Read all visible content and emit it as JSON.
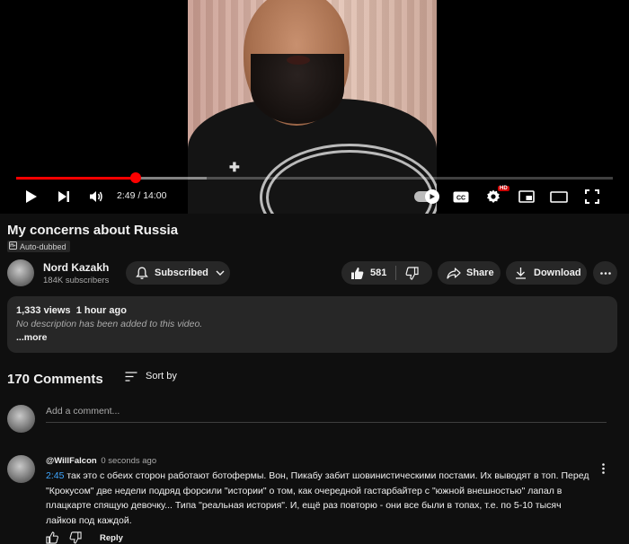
{
  "player": {
    "time_current": "2:49",
    "time_separator": " / ",
    "time_total": "14:00",
    "progress": {
      "played_fraction": 0.2,
      "buffered_fraction": 0.32
    },
    "settings_badge": "HD",
    "accent_color": "#ff0000"
  },
  "video": {
    "title": "My concerns about Russia",
    "dub_badge": "Auto-dubbed"
  },
  "channel": {
    "name": "Nord Kazakh",
    "subscribers": "184K subscribers",
    "subscribe_label": "Subscribed"
  },
  "actions": {
    "like_count": "581",
    "share_label": "Share",
    "download_label": "Download"
  },
  "description": {
    "views": "1,333 views",
    "age": "1 hour ago",
    "text": "No description has been added to this video.",
    "more_label": "...more"
  },
  "comments": {
    "count_label": "170 Comments",
    "sort_label": "Sort by",
    "add_placeholder": "Add a comment...",
    "items": [
      {
        "author": "@WillFalcon",
        "time": "0 seconds ago",
        "timestamp_link": "2:45",
        "text": " так это с обеих сторон работают ботофермы. Вон, Пикабу забит шовинистическими постами. Их выводят в топ. Перед \"Крокусом\" две недели подряд форсили \"истории\" о том, как очередной гастарбайтер с \"южной внешностью\" лапал в плацкарте спящую девочку... Типа \"реальная история\". И, ещё раз повторю - они все были в топах, т.е. по 5-10 тысяч лайков под каждой.",
        "reply_label": "Reply"
      }
    ]
  },
  "icons": {
    "play": "play-icon",
    "next": "next-icon",
    "volume": "volume-icon",
    "autoplay": "autoplay-toggle",
    "captions": "cc-icon",
    "settings": "gear-icon",
    "miniplayer": "miniplayer-icon",
    "theater": "theater-icon",
    "fullscreen": "fullscreen-icon",
    "bell": "bell-icon",
    "chevron": "chevron-down-icon",
    "like": "thumbs-up-icon",
    "dislike": "thumbs-down-icon",
    "share": "share-arrow-icon",
    "download": "download-icon",
    "more": "more-horizontal-icon",
    "sort": "sort-lines-icon",
    "kebab": "more-vertical-icon",
    "dub": "dub-audio-icon"
  }
}
